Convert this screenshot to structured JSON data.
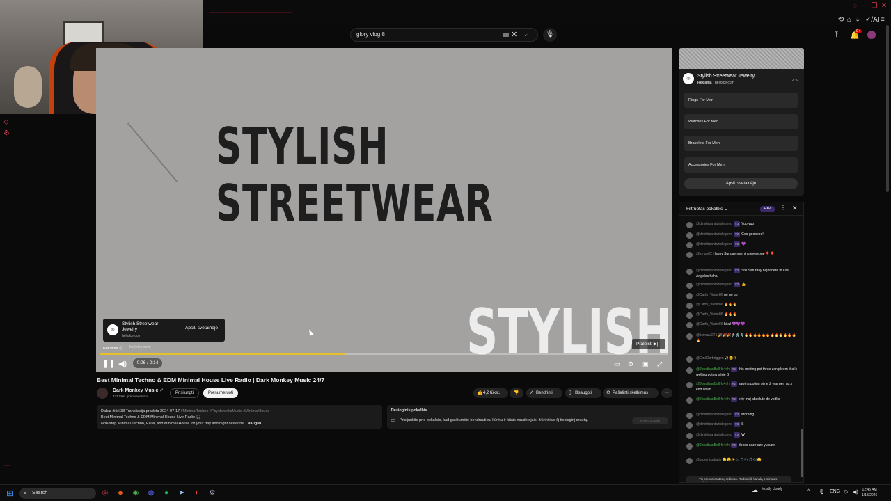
{
  "search": {
    "query": "glory vlog 8"
  },
  "header": {
    "ai_label": "AI",
    "notif_count": "9+"
  },
  "video": {
    "overlay_line1": "STYLISH",
    "overlay_line2": "STREETWEAR",
    "overlay_bottom": "STYLISH",
    "progress": 0.43,
    "ad_card": {
      "name": "Stylish Streetwear Jewelry",
      "domain": "hellolce.com",
      "button": "Apsil. svetainėje"
    },
    "ad_footer": {
      "label": "Reklama",
      "domain": "hellolce.com"
    },
    "time": "0:06 / 0:14",
    "skip": "Praleisti"
  },
  "info": {
    "title": "Best Minimal Techno & EDM Minimal House Live Radio | Dark Monkey Music 24/7",
    "channel": "Dark Monkey Music",
    "subs": "743 tūkst. prenumeratorių",
    "join": "Prisijungti",
    "subscribe": "Prenumeruoti",
    "likes": "4,2 tūkst.",
    "share": "Bendrinti",
    "save": "Išsaugoti",
    "report": "Pašalinti skelbimus",
    "desc_line1a": "Dabar žiūri 33  Transliacija pradėta 2024-07-17 ",
    "desc_tags": "#MinimalTechno #PsychedelicMusic #MinimalHouse",
    "desc_line2": "Best Minimal Techno & EDM Minimal House Live Radio 🎧",
    "desc_line3": "Non-stop Minimal Techno, EDM, and Minimal House for your day and night sessions ",
    "desc_more": "...daugiau",
    "live_title": "Tiesioginis pokalbis",
    "live_body": "Prisijunkite prie pokalbio, kad galėtumėte bendrauti su kūrėju ir kitais naudotojais, žiūrinčiais šį tiesioginį srautą.",
    "live_btn": "Rodyti pokalbį"
  },
  "adpanel": {
    "name": "Stylish Streetwear Jewelry",
    "sponsor": "Reklama",
    "domain": "hellolce.com",
    "links": [
      "Rings For Men",
      "Watches For Men",
      "Bracelets For Men",
      "Accessories For Men"
    ],
    "visit": "Apsil. svetainėje"
  },
  "chat": {
    "title": "Filtruotas pokalbis",
    "badge": "EXP",
    "messages": [
      {
        "author": "@dimitripantazislegend",
        "badge": "#3",
        "text": "Yup yup",
        "green": false
      },
      {
        "author": "@dimitripantazislegend",
        "badge": "#3",
        "text": "Goo goooooo!!",
        "green": false
      },
      {
        "author": "@dimitripantazislegend",
        "badge": "#3",
        "text": "💜",
        "green": false
      },
      {
        "author": "@zmun02",
        "badge": "",
        "text": "Happy Sunday morning everyone 🎈🎈",
        "green": false
      },
      {
        "author": "@dimitripantazislegend",
        "badge": "#3",
        "text": "Still Saturday night here in Los Angeles haha",
        "green": false
      },
      {
        "author": "@dimitripantazislegend",
        "badge": "#3",
        "text": "👍",
        "green": false
      },
      {
        "author": "@Darth_Vader86",
        "badge": "",
        "text": "go go go",
        "green": false
      },
      {
        "author": "@Darth_Vader86",
        "badge": "",
        "text": "🔥🔥🔥",
        "green": false
      },
      {
        "author": "@Darth_Vader86",
        "badge": "",
        "text": "🔥🔥🔥",
        "green": false
      },
      {
        "author": "@Darth_Vader86",
        "badge": "",
        "text": "hi all 💜💜💜",
        "green": false
      },
      {
        "author": "@lizmuza271",
        "badge": "",
        "text": "🎉🎉🎉🕺🕺🕺🔥🔥🔥🔥🔥🔥🔥🔥🔥🔥🔥🔥🔥",
        "green": false
      },
      {
        "author": "@EmilDarbriggen",
        "badge": "",
        "text": "✨😊✨",
        "green": false
      },
      {
        "author": "@JonathanBall-fx4nh",
        "badge": "#2",
        "text": "this melting pot thrue zen pleem that's welling poting série B",
        "green": true
      },
      {
        "author": "@JonathanBall-fx4nh",
        "badge": "#2",
        "text": "sawing poting série Z war pen up,s end down",
        "green": true
      },
      {
        "author": "@JonathanBall-fx4nh",
        "badge": "#2",
        "text": "erty maj absolute de vodka",
        "green": true
      },
      {
        "author": "@dimitripantazislegend",
        "badge": "#3",
        "text": "Morning",
        "green": false
      },
      {
        "author": "@dimitripantazislegend",
        "badge": "#3",
        "text": "S",
        "green": false
      },
      {
        "author": "@dimitripantazislegend",
        "badge": "#3",
        "text": "W",
        "green": false
      },
      {
        "author": "@JonathanBall-fx4nh",
        "badge": "#2",
        "text": "doose saze aze yu saw",
        "green": true
      },
      {
        "author": "@laurentsabatie",
        "badge": "",
        "text": "😊😉✨🎶🎵🎶🎵🎶😊",
        "green": false
      }
    ],
    "footer": "Tik prenumeratorių režimas. Rodomi šį kanalą 5 minutes ar ilgiau prenumeruojantys naudotojai."
  },
  "taskbar": {
    "search": "Search",
    "lang": "ENG",
    "time": "12:45 AM",
    "date": "1/18/2026",
    "weather": "Mostly cloudy"
  },
  "colors": {
    "accent": "#e6c12b",
    "brand_red": "#c43b4a"
  }
}
